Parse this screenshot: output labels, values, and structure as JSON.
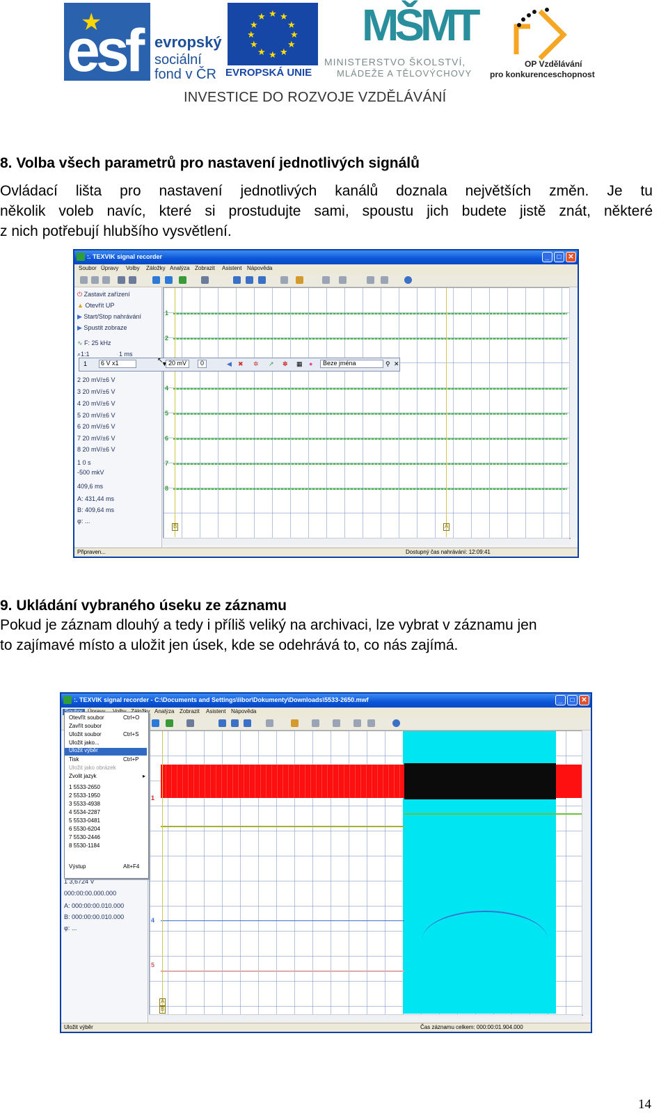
{
  "logos": {
    "esf_letters": "esf",
    "esf_line1": "evropský",
    "esf_line2": "sociální",
    "esf_line3": "fond v ČR",
    "eu_label": "EVROPSKÁ UNIE",
    "msmt_mark": "MŠMT",
    "msmt_line1": "MINISTERSTVO ŠKOLSTVÍ,",
    "msmt_line2": "MLÁDEŽE A TĚLOVÝCHOVY",
    "op_line1": "OP Vzdělávání",
    "op_line2": "pro konkurenceschopnost",
    "banner": "INVESTICE DO ROZVOJE VZDĚLÁVÁNÍ"
  },
  "section8": {
    "heading": "8. Volba všech parametrů pro nastavení jednotlivých signálů",
    "lines": [
      "Ovládací lišta pro nastavení jednotlivých kanálů doznala největších změn. Je tu",
      "několik voleb navíc, které si prostudujte sami, spoustu jich budete jistě znát, některé",
      "z nich potřebují hlubšího vysvětlení."
    ]
  },
  "window1": {
    "title": ":. TEXVIK  signal recorder",
    "menu": [
      "Soubor",
      "Úpravy",
      "Volby",
      "Záložky",
      "Analýza",
      "Zobrazit",
      "Asistent",
      "Nápověda"
    ],
    "panel": [
      "Zastavit zařízení",
      "Otevřít UP",
      "Start/Stop nahrávání",
      "Spustit zobraze",
      "F: 25 kHz",
      "1:1",
      "1 ms"
    ],
    "channels": [
      "2 20 mV/±6 V",
      "3 20 mV/±6 V",
      "4 20 mV/±6 V",
      "5 20 mV/±6 V",
      "6 20 mV/±6 V",
      "7 20 mV/±6 V",
      "8 20 mV/±6 V"
    ],
    "trigger": [
      "1  0 s",
      "-500 mkV"
    ],
    "measures": [
      "409,6 ms",
      "A: 431,44 ms",
      "B: 409,64 ms",
      "φ: ..."
    ],
    "popup": {
      "ch": "1",
      "range": "6 V x1",
      "mv": "20 mV",
      "offset": "0",
      "name": "Beze jména"
    },
    "ch_labels": [
      "1",
      "2",
      "3",
      "4",
      "5",
      "6",
      "7",
      "8"
    ],
    "cursor_a": "A",
    "cursor_b": "B",
    "status_left": "Připraven...",
    "status_right": "Dostupný čas nahrávání: 12:09:41"
  },
  "section9": {
    "heading": "9. Ukládání vybraného úseku ze záznamu",
    "lines": [
      "Pokud je záznam dlouhý a tedy i příliš veliký na archivaci, lze vybrat v záznamu jen",
      "to zajímavé místo a uložit jen úsek, kde se odehrává to, co nás zajímá."
    ]
  },
  "window2": {
    "title": ":. TEXVIK  signal recorder  -  C:\\Documents and Settings\\libor\\Dokumenty\\Downloads\\5533-2650.mwf",
    "menu": [
      "Soubor",
      "Úpravy",
      "Volby",
      "Záložky",
      "Analýza",
      "Zobrazit",
      "Asistent",
      "Nápověda"
    ],
    "file_menu": [
      {
        "label": "Otevřít soubor",
        "shortcut": "Ctrl+O"
      },
      {
        "label": "Zavřít soubor",
        "shortcut": ""
      },
      {
        "label": "Uložit soubor",
        "shortcut": "Ctrl+S"
      },
      {
        "label": "Uložit jako...",
        "shortcut": ""
      },
      {
        "label": "Uložit výběr",
        "shortcut": ""
      },
      {
        "label": "Tisk",
        "shortcut": "Ctrl+P"
      },
      {
        "label": "Uložit jako obrázek",
        "shortcut": ""
      },
      {
        "label": "Zvolit jazyk",
        "shortcut": ""
      }
    ],
    "recent": [
      "1 5533-2650",
      "2 5533-1950",
      "3 5533-4938",
      "4 5534-2287",
      "5 5533-0481",
      "6 5530-6204",
      "7 5530-2446",
      "8 5530-1184"
    ],
    "exit": {
      "label": "Výstup",
      "shortcut": "Alt+F4"
    },
    "panel": [
      "1  3,6724 V",
      "000:00:00.000.000",
      "A: 000:00:00.010.000",
      "B: 000:00:00.010.000",
      "φ: ..."
    ],
    "ch_labels": [
      "1",
      "4",
      "5"
    ],
    "cursor_a": "A",
    "cursor_b": "B",
    "status_left": "Uložit výběr",
    "status_right": "Čas záznamu celkem: 000:00:01.904.000"
  },
  "page_number": "14",
  "colors": {
    "esf_blue": "#2a62ad",
    "eu_blue": "#1747a6",
    "msmt_teal": "#2a8f9c",
    "titlebar": "#0a55d6",
    "selection_cyan": "#00e5f2",
    "signal_red": "#ff1010",
    "signal_green": "#46b246"
  }
}
